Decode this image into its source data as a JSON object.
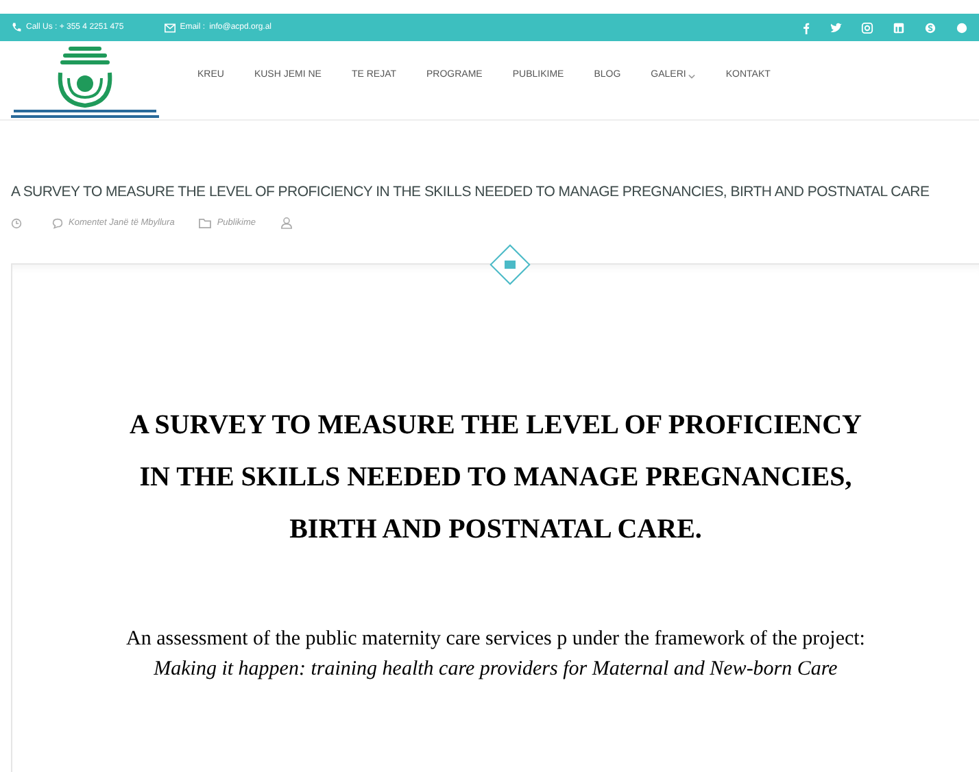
{
  "top_bar": {
    "phone": "Call Us : + 355 4 2251 475",
    "email_label": "Email :",
    "email": "info@acpd.org.al"
  },
  "nav": [
    {
      "label": "KREU",
      "dropdown": false
    },
    {
      "label": "KUSH JEMI NE",
      "dropdown": false
    },
    {
      "label": "TE REJAT",
      "dropdown": false
    },
    {
      "label": "PROGRAME",
      "dropdown": false
    },
    {
      "label": "PUBLIKIME",
      "dropdown": false
    },
    {
      "label": "BLOG",
      "dropdown": false
    },
    {
      "label": "GALERI",
      "dropdown": true
    },
    {
      "label": "KONTAKT",
      "dropdown": false
    }
  ],
  "post": {
    "title": "A SURVEY TO MEASURE THE LEVEL OF PROFICIENCY IN THE SKILLS NEEDED TO MANAGE PREGNANCIES, BIRTH AND POSTNATAL CARE",
    "comments": "Komentet Janë të Mbyllura",
    "category": "Publikime"
  },
  "document": {
    "heading": [
      "A SURVEY TO MEASURE THE LEVEL OF PROFICIENCY",
      "IN THE SKILLS NEEDED TO MANAGE PREGNANCIES,",
      "BIRTH AND POSTNATAL CARE."
    ],
    "intro": "An assessment of the public maternity care services p under the framework of the project:",
    "project": "Making it happen: training health care providers for Maternal and New-born Care"
  }
}
